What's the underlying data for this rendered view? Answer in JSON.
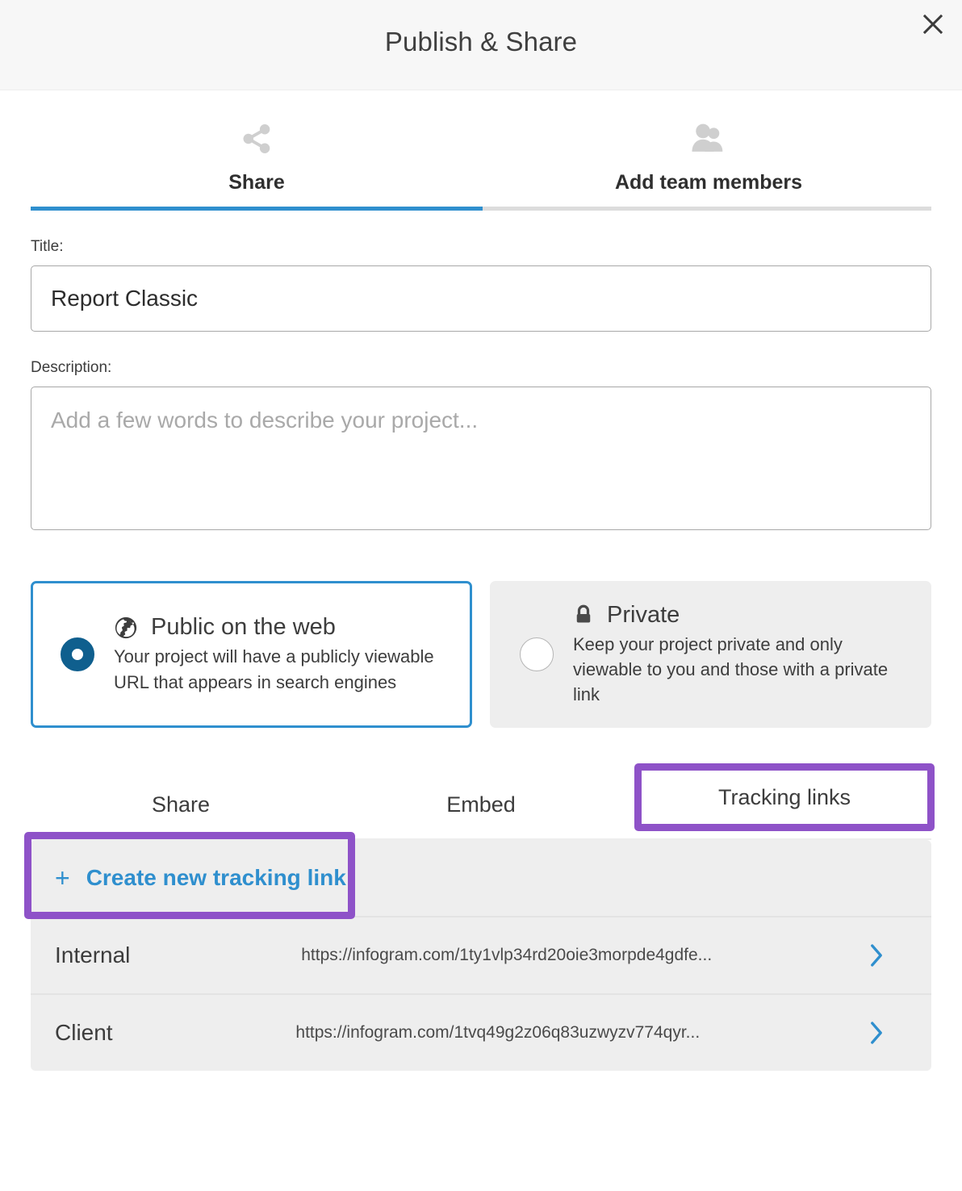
{
  "dialog": {
    "title": "Publish & Share",
    "close_label": "close-icon"
  },
  "top_tabs": [
    {
      "label": "Share",
      "icon": "share-nodes-icon",
      "active": true
    },
    {
      "label": "Add team members",
      "icon": "people-icon",
      "active": false
    }
  ],
  "form": {
    "title_label": "Title:",
    "title_value": "Report Classic",
    "title_placeholder": "",
    "description_label": "Description:",
    "description_value": "",
    "description_placeholder": "Add a few words to describe your project..."
  },
  "visibility": {
    "selected": "public",
    "options": [
      {
        "id": "public",
        "icon": "globe-icon",
        "name": "Public on the web",
        "description": "Your project will have a publicly viewable URL that appears in search engines"
      },
      {
        "id": "private",
        "icon": "lock-icon",
        "name": "Private",
        "description": "Keep your project private and only viewable to you and those with a private link"
      }
    ]
  },
  "inner_tabs": {
    "items": [
      {
        "label": "Share",
        "active": false
      },
      {
        "label": "Embed",
        "active": false
      },
      {
        "label": "Tracking links",
        "active": true
      }
    ],
    "highlight_color": "#8e52c8"
  },
  "tracking": {
    "create_plus": "+",
    "create_label": "Create new tracking link",
    "rows": [
      {
        "name": "Internal",
        "url": "https://infogram.com/1ty1vlp34rd20oie3morpde4gdfe...",
        "chevron": "chevron-right-icon"
      },
      {
        "name": "Client",
        "url": "https://infogram.com/1tvq49g2z06q83uzwyzv774qyr...",
        "chevron": "chevron-right-icon"
      }
    ]
  },
  "colors": {
    "accent_blue": "#2f8fce",
    "radio_selected": "#0f5f8e",
    "highlight_purple": "#8e52c8",
    "header_bg": "#f7f7f7",
    "row_bg": "#eeeeee"
  }
}
